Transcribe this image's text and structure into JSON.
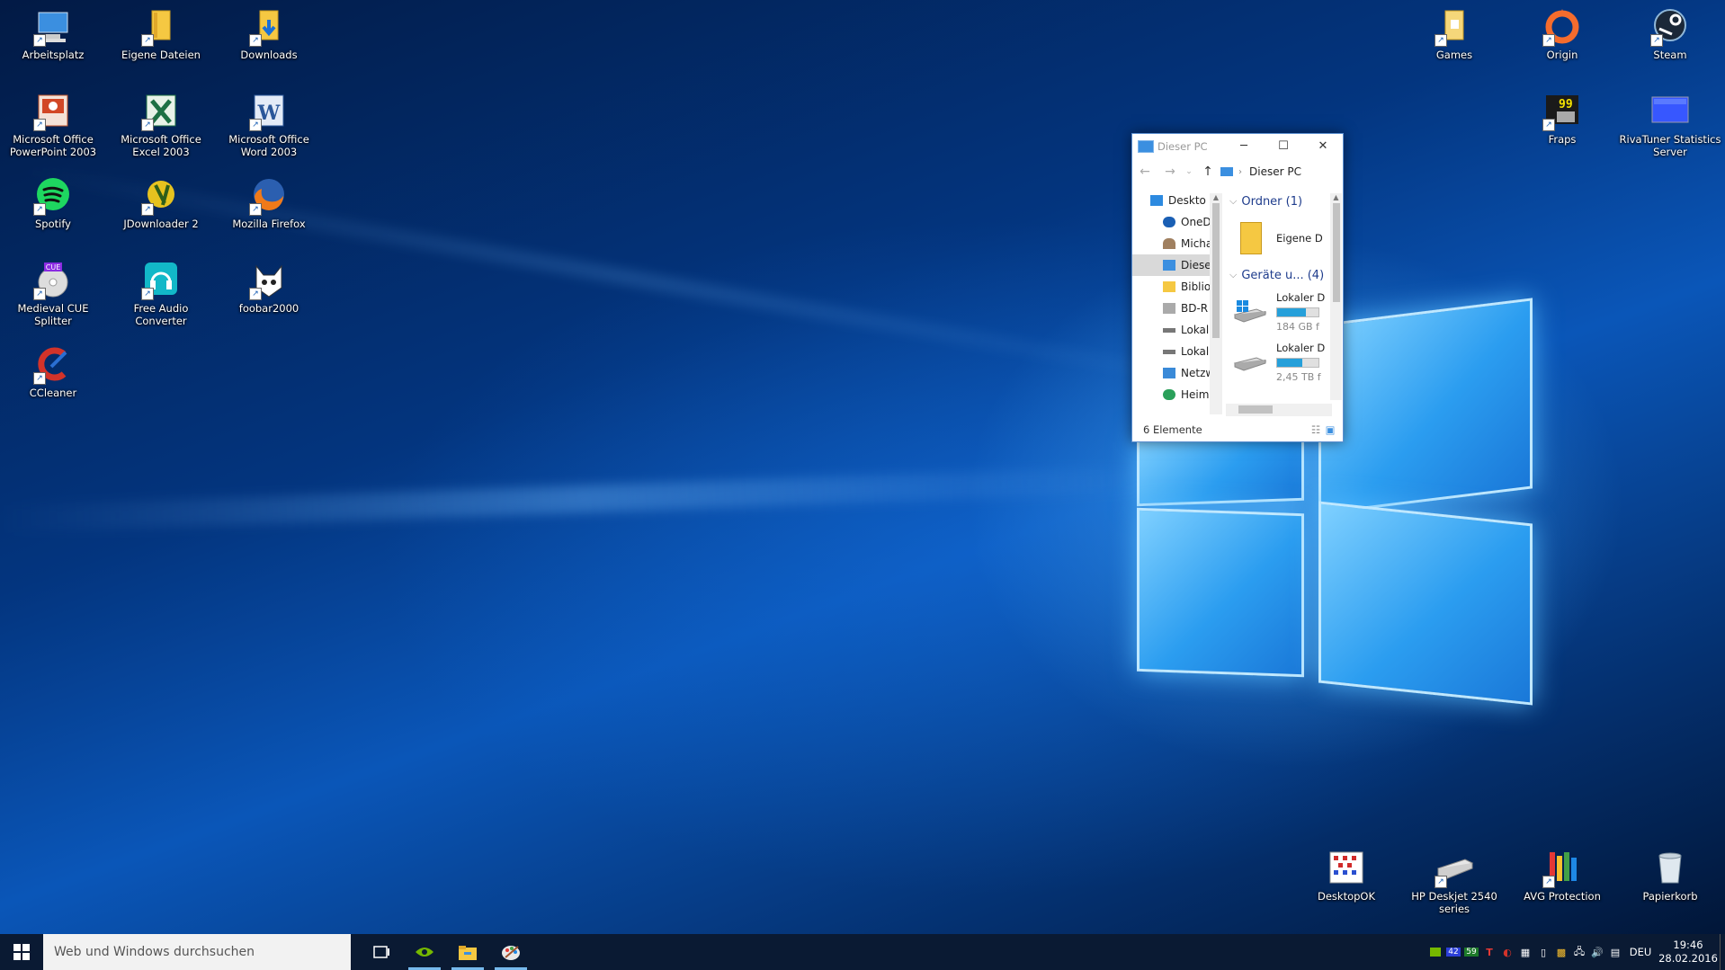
{
  "desktop": {
    "icons": [
      {
        "label": "Arbeitsplatz",
        "icon": "computer-icon"
      },
      {
        "label": "Eigene Dateien",
        "icon": "folder-icon"
      },
      {
        "label": "Downloads",
        "icon": "downloads-folder-icon"
      },
      {
        "label": "Microsoft Office PowerPoint 2003",
        "icon": "powerpoint-icon"
      },
      {
        "label": "Microsoft Office Excel 2003",
        "icon": "excel-icon"
      },
      {
        "label": "Microsoft Office Word 2003",
        "icon": "word-icon"
      },
      {
        "label": "Spotify",
        "icon": "spotify-icon"
      },
      {
        "label": "JDownloader 2",
        "icon": "jdownloader-icon"
      },
      {
        "label": "Mozilla Firefox",
        "icon": "firefox-icon"
      },
      {
        "label": "Medieval CUE Splitter",
        "icon": "cue-splitter-icon"
      },
      {
        "label": "Free Audio Converter",
        "icon": "audio-converter-icon"
      },
      {
        "label": "foobar2000",
        "icon": "foobar-icon"
      },
      {
        "label": "CCleaner",
        "icon": "ccleaner-icon"
      },
      {
        "label": "Games",
        "icon": "games-folder-icon"
      },
      {
        "label": "Origin",
        "icon": "origin-icon"
      },
      {
        "label": "Steam",
        "icon": "steam-icon"
      },
      {
        "label": "Fraps",
        "icon": "fraps-icon"
      },
      {
        "label": "RivaTuner Statistics Server",
        "icon": "rivatuner-icon"
      },
      {
        "label": "DesktopOK",
        "icon": "desktopok-icon"
      },
      {
        "label": "HP Deskjet 2540 series",
        "icon": "printer-icon"
      },
      {
        "label": "AVG Protection",
        "icon": "avg-icon"
      },
      {
        "label": "Papierkorb",
        "icon": "recycle-bin-icon"
      }
    ]
  },
  "explorer": {
    "title": "Dieser PC",
    "address": "Dieser PC",
    "nav_items": [
      "Deskto",
      "OneD",
      "Micha",
      "Dieser",
      "Biblio",
      "BD-R",
      "Lokal",
      "Lokal",
      "Netzw",
      "Heim"
    ],
    "groups": {
      "folders_label": "Ordner (1)",
      "folder_item": "Eigene D",
      "devices_label": "Geräte u... (4)",
      "drives": [
        {
          "name": "Lokaler D",
          "free": "184 GB f",
          "used_fraction": 0.7
        },
        {
          "name": "Lokaler D",
          "free": "2,45 TB f",
          "used_fraction": 0.6
        }
      ]
    },
    "status": "6 Elemente"
  },
  "taskbar": {
    "search_placeholder": "Web und Windows durchsuchen",
    "tray": {
      "num_badge": "42",
      "num_badge2": "59",
      "language": "DEU",
      "time": "19:46",
      "date": "28.02.2016"
    }
  },
  "colors": {
    "accent": "#26a0da",
    "taskbar": "#0a1a33",
    "desktop": "#0a56b8"
  }
}
